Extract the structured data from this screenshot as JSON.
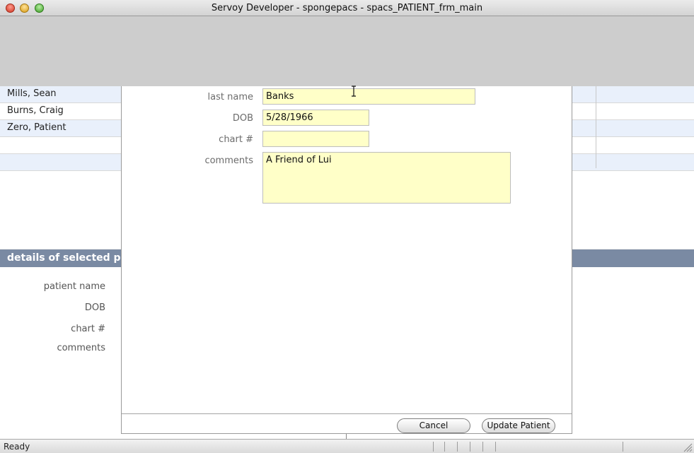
{
  "window": {
    "title": "Servoy Developer - spongepacs - spacs_PATIENT_frm_main"
  },
  "patient_list": {
    "rows": [
      {
        "name": "Mills, Sean"
      },
      {
        "name": "Burns, Craig"
      },
      {
        "name": "Zero, Patient"
      },
      {
        "name": ""
      },
      {
        "name": ""
      }
    ]
  },
  "details": {
    "header": "details of selected pati",
    "labels": {
      "patient_name": "patient name",
      "dob": "DOB",
      "chart": "chart #",
      "comments": "comments"
    }
  },
  "dialog": {
    "fields": {
      "last_name": {
        "label": "last name",
        "value": "Banks"
      },
      "dob": {
        "label": "DOB",
        "value": "5/28/1966"
      },
      "chart": {
        "label": "chart #",
        "value": ""
      },
      "comments": {
        "label": "comments",
        "value": "A Friend of Lui"
      }
    },
    "buttons": {
      "cancel": "Cancel",
      "update": "Update Patient"
    }
  },
  "statusbar": {
    "text": "Ready"
  },
  "colors": {
    "field_bg": "#ffffc8",
    "header_bg": "#7a8aa3",
    "row_alt": "#e9f0fb"
  }
}
